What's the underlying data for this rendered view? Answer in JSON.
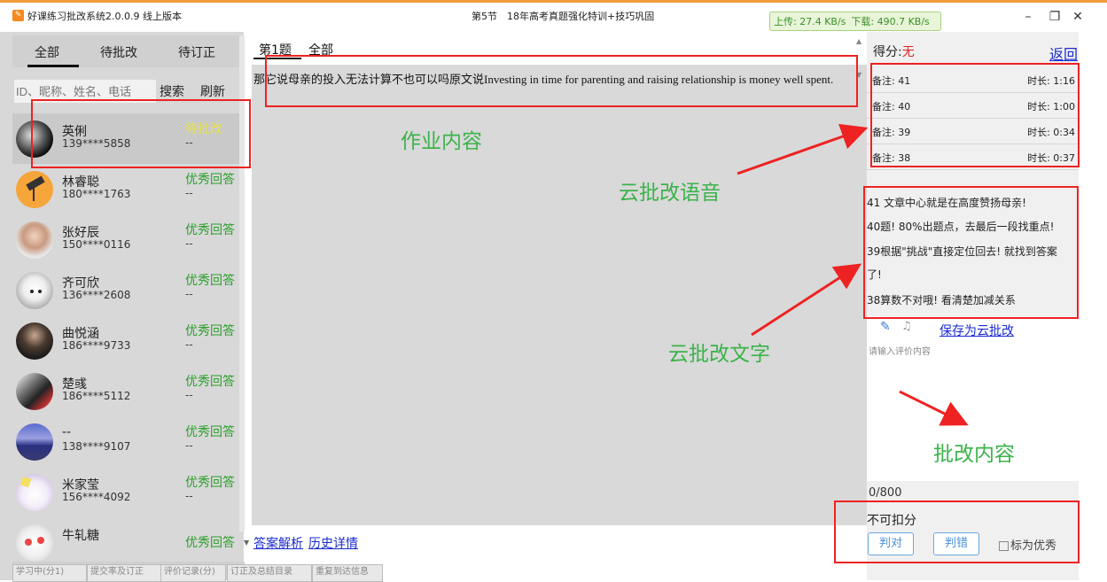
{
  "window": {
    "app_title": "好课练习批改系统2.0.0.9 线上版本",
    "section_title": "第5节　18年高考真题强化特训+技巧巩固",
    "upload_speed": "上传: 27.4 KB/s",
    "download_speed": "下载: 490.7 KB/s",
    "minimize": "–",
    "restore": "❐",
    "close": "✕"
  },
  "left": {
    "tabs": [
      "全部",
      "待批改",
      "待订正"
    ],
    "search_placeholder": "ID、昵称、姓名、电话",
    "search_button": "搜索",
    "refresh_button": "刷新",
    "students": [
      {
        "name": "英俐",
        "phone": "139****5858",
        "status": "待批改",
        "sub": "--"
      },
      {
        "name": "林睿聪",
        "phone": "180****1763",
        "status": "优秀回答",
        "sub": "--"
      },
      {
        "name": "张好辰",
        "phone": "150****0116",
        "status": "优秀回答",
        "sub": "--"
      },
      {
        "name": "齐可欣",
        "phone": "136****2608",
        "status": "优秀回答",
        "sub": "--"
      },
      {
        "name": "曲悦涵",
        "phone": "186****9733",
        "status": "优秀回答",
        "sub": "--"
      },
      {
        "name": "楚彧",
        "phone": "186****5112",
        "status": "优秀回答",
        "sub": "--"
      },
      {
        "name": "--",
        "phone": "138****9107",
        "status": "优秀回答",
        "sub": "--"
      },
      {
        "name": "米家莹",
        "phone": "156****4092",
        "status": "优秀回答",
        "sub": "--"
      },
      {
        "name": "牛轧糖",
        "phone": "",
        "status": "优秀回答",
        "sub": ""
      }
    ],
    "bottom_tabs": [
      "学习中(分1)",
      "提交率及订正",
      "评价记录(分)",
      "订正及总结目录",
      "重复到达信息"
    ]
  },
  "middle": {
    "tab1": "第1题",
    "tab2": "全部",
    "homework_text": "那它说母亲的投入无法计算不也可以吗原文说Investing in time for parenting and raising relationship is money well spent.",
    "answer_link": "答案解析",
    "history_link": "历史详情"
  },
  "right": {
    "score_label": "得分:",
    "score_value": "无",
    "back": "返回",
    "voices": [
      {
        "note": "备注: 41",
        "duration": "时长: 1:16"
      },
      {
        "note": "备注: 40",
        "duration": "时长: 1:00"
      },
      {
        "note": "备注: 39",
        "duration": "时长: 0:34"
      },
      {
        "note": "备注: 38",
        "duration": "时长: 0:37"
      }
    ],
    "texts": [
      "41 文章中心就是在高度赞扬母亲!",
      "40题! 80%出题点，去最后一段找重点!",
      "39根据\"挑战\"直接定位回去! 就找到答案",
      "了!",
      "38算数不对哦! 看清楚加减关系"
    ],
    "save_cloud": "保存为云批改",
    "comment_placeholder": "请输入评价内容",
    "counter": "0/800",
    "no_deduct": "不可扣分",
    "judge_right": "判对",
    "judge_wrong": "判错",
    "mark_excellent": "标为优秀"
  },
  "annotations": {
    "homework": "作业内容",
    "voice": "云批改语音",
    "text": "云批改文字",
    "grading": "批改内容"
  },
  "colors": {
    "annotation_red": "#e22222",
    "annotation_green": "#3bb34a",
    "link_blue": "#1a2bd0"
  }
}
